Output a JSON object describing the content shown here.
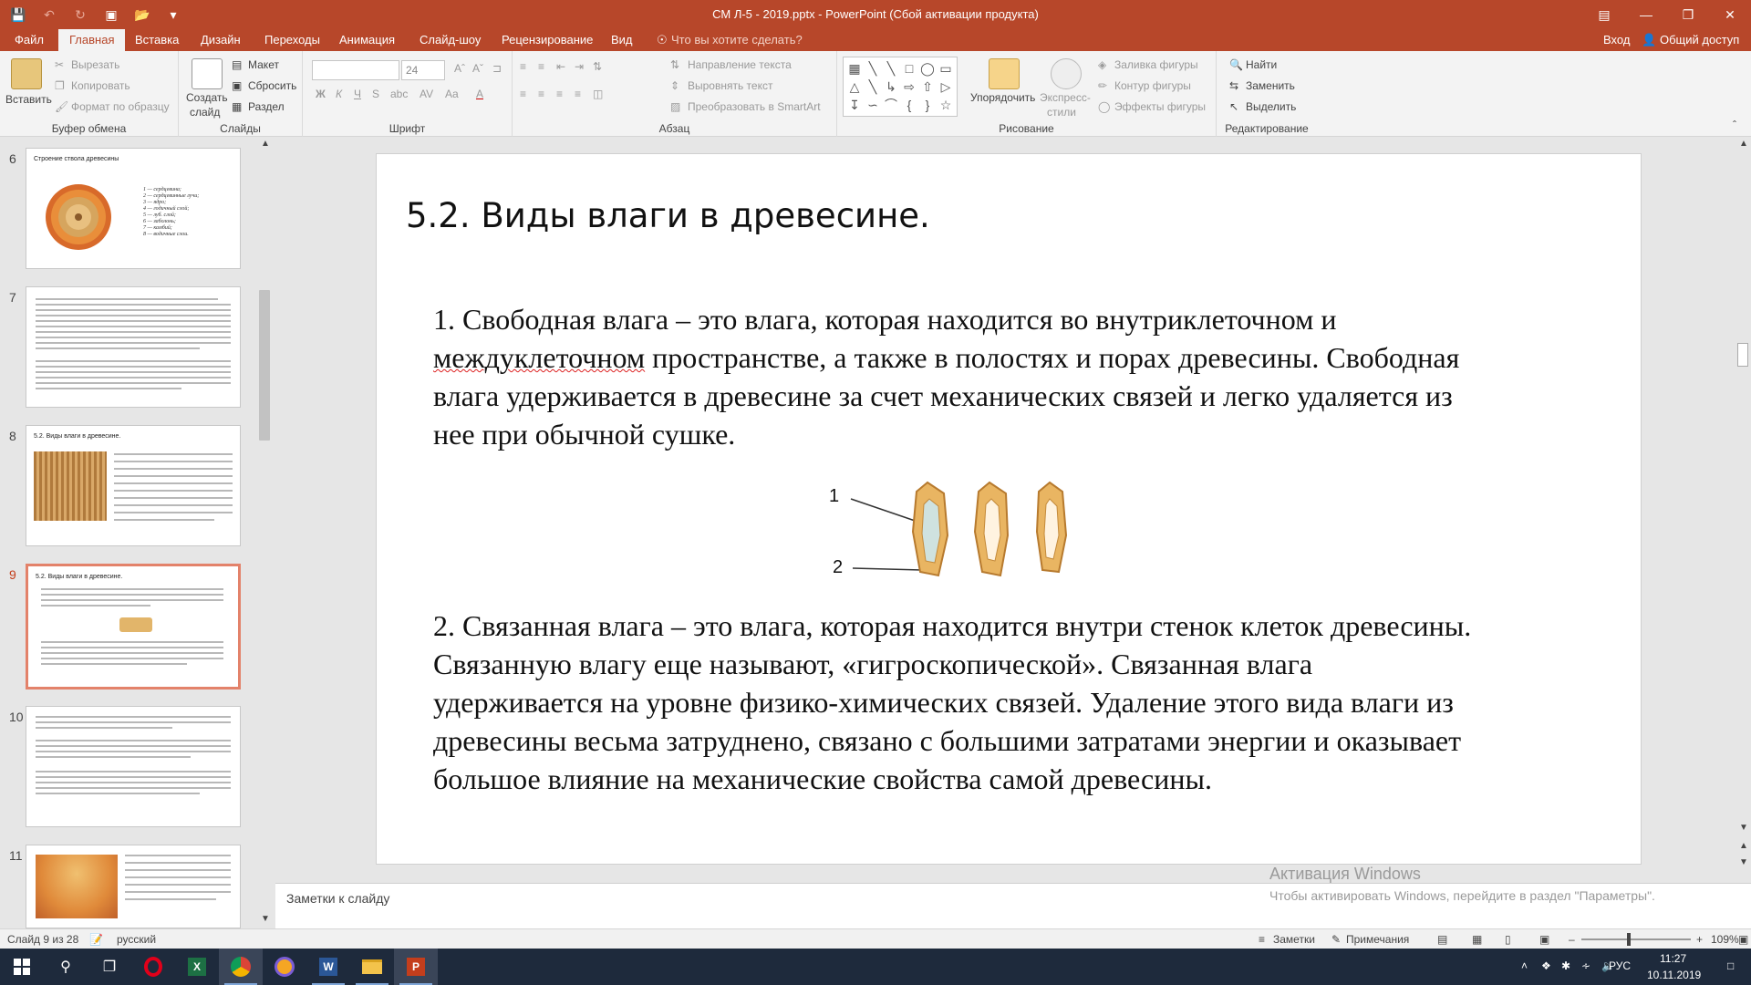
{
  "window": {
    "title": "СМ Л-5 - 2019.pptx  -  PowerPoint (Сбой активации продукта)"
  },
  "qat": {
    "save_icon": "save-icon",
    "undo_icon": "undo-icon",
    "redo_icon": "redo-icon",
    "present_icon": "present-icon",
    "open_icon": "open-icon",
    "more_icon": "more-icon"
  },
  "tabs": [
    "Файл",
    "Главная",
    "Вставка",
    "Дизайн",
    "Переходы",
    "Анимация",
    "Слайд-шоу",
    "Рецензирование",
    "Вид"
  ],
  "tell_me": "Что вы хотите сделать?",
  "signin": "Вход",
  "share": "Общий доступ",
  "ribbon": {
    "clipboard": {
      "paste": "Вставить",
      "cut": "Вырезать",
      "copy": "Копировать",
      "format_painter": "Формат по образцу",
      "label": "Буфер обмена"
    },
    "slides": {
      "new_slide": "Создать",
      "new_slide2": "слайд",
      "layout": "Макет",
      "reset": "Сбросить",
      "section": "Раздел",
      "label": "Слайды"
    },
    "font": {
      "size": "24",
      "label": "Шрифт",
      "bold": "Ж",
      "italic": "К",
      "underline": "Ч",
      "strike": "S",
      "shadow": "abc",
      "spacing": "AV",
      "case": "Aa",
      "color": "A"
    },
    "paragraph": {
      "text_direction": "Направление текста",
      "align_text": "Выровнять текст",
      "smartart": "Преобразовать в SmartArt",
      "label": "Абзац"
    },
    "drawing": {
      "arrange": "Упорядочить",
      "quick_styles": "Экспресс-",
      "quick_styles2": "стили",
      "fill": "Заливка фигуры",
      "outline": "Контур фигуры",
      "effects": "Эффекты фигуры",
      "label": "Рисование"
    },
    "editing": {
      "find": "Найти",
      "replace": "Заменить",
      "select": "Выделить",
      "label": "Редактирование"
    }
  },
  "thumbnails": [
    {
      "num": "6",
      "title": "Строение ствола древесины",
      "legend": [
        "1 — сердцевина;",
        "2 — сердцевинные лучи;",
        "3 — ядро;",
        "4 — годичный слой;",
        "5 — луб. слой;",
        "6 — заболонь;",
        "7 — камбий;",
        "8 — водичные слои."
      ]
    },
    {
      "num": "7"
    },
    {
      "num": "8",
      "title": "5.2. Виды влаги в древесине."
    },
    {
      "num": "9",
      "title": "5.2. Виды влаги в древесине."
    },
    {
      "num": "10"
    },
    {
      "num": "11"
    }
  ],
  "slide": {
    "title": "5.2. Виды влаги в древесине.",
    "p1_a": "1. Свободная влага – это влага, которая находится во внутриклеточном и",
    "p1_b": "междуклеточном",
    "p1_c": " пространстве, а также в полостях и порах древесины. Свободная",
    "p1_d": "влага удерживается в древесине за счет механических связей и легко удаляется из",
    "p1_e": "нее при обычной сушке.",
    "label1": "1",
    "label2": "2",
    "p2_a": "2. Связанная влага – это влага, которая находится внутри стенок клеток древесины.",
    "p2_b": "Связанную влагу еще называют, «гигроскопической». Связанная влага",
    "p2_c": "удерживается на уровне физико-химических связей. Удаление этого вида влаги из",
    "p2_d": "древесины весьма затруднено, связано с большими затратами энергии и оказывает",
    "p2_e": "большое влияние на механические свойства самой древесины."
  },
  "notes_placeholder": "Заметки к слайду",
  "activation": {
    "line1": "Активация Windows",
    "line2": "Чтобы активировать Windows, перейдите в раздел \"Параметры\"."
  },
  "status": {
    "slide": "Слайд 9 из 28",
    "lang": "русский",
    "notes": "Заметки",
    "comments": "Примечания",
    "zoom": "109%"
  },
  "taskbar": {
    "lang": "РУС",
    "time": "11:27",
    "date": "10.11.2019"
  }
}
